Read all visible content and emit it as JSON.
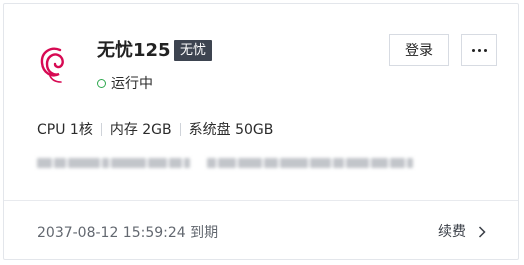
{
  "instance": {
    "name": "无忧125",
    "tag": "无忧",
    "os_icon": "debian-logo-icon",
    "status": "运行中",
    "status_color": "#2fa84f"
  },
  "actions": {
    "login_label": "登录",
    "more_icon": "more-icon"
  },
  "specs": {
    "cpu": "CPU 1核",
    "memory": "内存 2GB",
    "disk": "系统盘 50GB"
  },
  "footer": {
    "expire": "2037-08-12 15:59:24 到期",
    "renew_label": "续费",
    "renew_icon": "chevron-right-icon"
  },
  "colors": {
    "tag_bg": "#3d4450",
    "logo": "#d70a53",
    "border": "#e3e6eb"
  }
}
